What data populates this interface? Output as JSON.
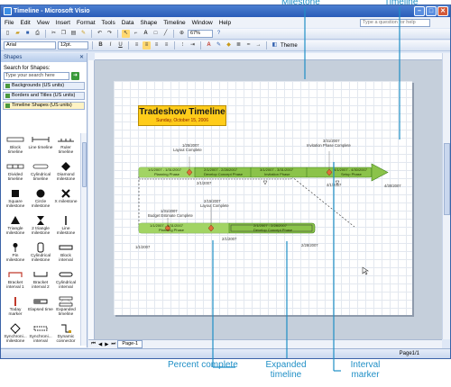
{
  "window": {
    "title": "Timeline - Microsoft Visio"
  },
  "menu": [
    "File",
    "Edit",
    "View",
    "Insert",
    "Format",
    "Tools",
    "Data",
    "Shape",
    "Timeline",
    "Window",
    "Help"
  ],
  "help_placeholder": "Type a question for help",
  "toolbar": {
    "zoom": "67%",
    "font": "Arial",
    "font_size": "12pt.",
    "theme": "Theme"
  },
  "shapes_pane": {
    "title": "Shapes",
    "search_label": "Search for Shapes:",
    "search_placeholder": "Type your search here",
    "stencils": [
      "Backgrounds (US units)",
      "Borders and Titles (US units)",
      "Timeline Shapes (US units)"
    ],
    "items": [
      "Block timeline",
      "Line timeline",
      "Ruler timeline",
      "Divided timeline",
      "Cylindrical timeline",
      "Diamond milestone",
      "Square milestone",
      "Circle milestone",
      "X milestone",
      "Triangle milestone",
      "2 triangle milestone",
      "Line milestone",
      "Pin milestone",
      "Cylindrical milestone",
      "Block interval",
      "Bracket interval 1",
      "Bracket interval 2",
      "Cylindrical interval",
      "Today marker",
      "Elapsed time",
      "Expanded timeline",
      "Synchroni... milestone",
      "Synchroni... interval",
      "Dynamic connector"
    ]
  },
  "diagram": {
    "title": "Tradeshow Timeline",
    "date": "Sunday, October 15, 2006",
    "milestones": [
      {
        "date": "1/25/2007",
        "label": "Layout Complete"
      },
      {
        "date": "3/31/2007",
        "label": "Invitation Phase Complete"
      },
      {
        "date": "2/15/2007",
        "label": "Layout Complete"
      },
      {
        "date": "1/31/2007",
        "label": "Budget Estimate Complete"
      }
    ],
    "main_phases": [
      {
        "range": "1/1/2007 - 1/31/2007",
        "name": "Planning Phase"
      },
      {
        "range": "2/1/2007 - 2/28/2007",
        "name": "Develop Concept Phase"
      },
      {
        "range": "3/1/2007 - 3/31/2007",
        "name": "Invitation Phase"
      },
      {
        "range": "4/1/2007 - 4/30/2007",
        "name": "Setup Phase"
      }
    ],
    "expanded_phases": [
      {
        "range": "1/1/2007 - 1/31/2007",
        "name": "Planning Phase"
      },
      {
        "range": "2/1/2007 - 2/28/2007",
        "name": "Develop Concept Phase"
      }
    ],
    "main_dates": [
      "2/1/2007",
      "4/1/2007",
      "4/30/2007"
    ],
    "expanded_dates": [
      "1/1/2007",
      "2/1/2007",
      "2/28/2007"
    ]
  },
  "tabs": [
    "Page-1"
  ],
  "status": {
    "page": "Page1/1"
  },
  "callouts": {
    "milestone": "Milestone",
    "timeline": "Timeline",
    "percent_complete": "Percent complete",
    "expanded_timeline": "Expanded timeline",
    "interval_marker": "Interval marker"
  },
  "colors": {
    "bar": "#8bc34a",
    "bar_dark": "#3f7f1c",
    "diamond": "#e0703a",
    "title_box": "#ffcc1a",
    "callout": "#1f8fc6"
  }
}
